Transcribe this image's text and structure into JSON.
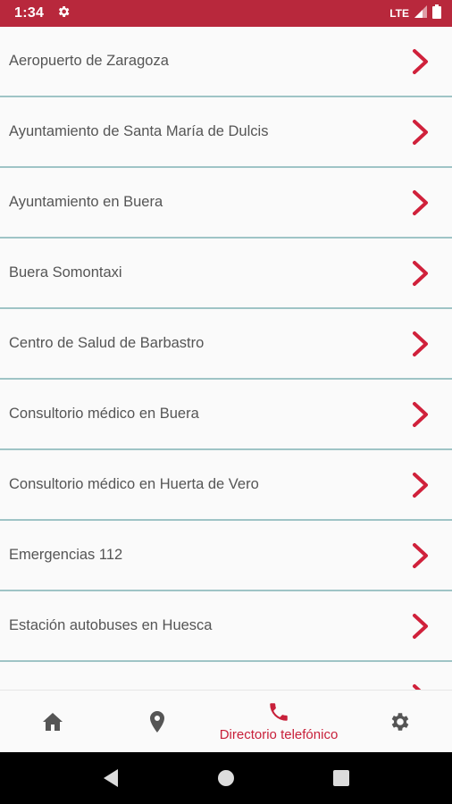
{
  "status_bar": {
    "time": "1:34",
    "network": "LTE",
    "background_color": "#b8283c",
    "icons": [
      "settings-gear-icon",
      "signal-icon",
      "battery-icon"
    ]
  },
  "directory": {
    "items": [
      {
        "label": "Aeropuerto de Zaragoza"
      },
      {
        "label": "Ayuntamiento de Santa María de Dulcis"
      },
      {
        "label": "Ayuntamiento en Buera"
      },
      {
        "label": "Buera Somontaxi"
      },
      {
        "label": "Centro de Salud de Barbastro"
      },
      {
        "label": "Consultorio médico en Buera"
      },
      {
        "label": "Consultorio médico en Huerta de Vero"
      },
      {
        "label": "Emergencias 112"
      },
      {
        "label": "Estación autobuses en Huesca"
      },
      {
        "label": ""
      }
    ],
    "chevron_color": "#d0213b",
    "divider_color": "#9fc4c6"
  },
  "bottom_nav": {
    "items": [
      {
        "name": "home",
        "icon": "home-icon",
        "label": ""
      },
      {
        "name": "map",
        "icon": "location-pin-icon",
        "label": ""
      },
      {
        "name": "directory",
        "icon": "phone-icon",
        "label": "Directorio telefónico",
        "active": true
      },
      {
        "name": "settings",
        "icon": "gear-icon",
        "label": ""
      }
    ],
    "active_color": "#c8203a",
    "inactive_color": "#555555"
  },
  "system_nav": {
    "buttons": [
      "back-icon",
      "home-circle-icon",
      "recents-square-icon"
    ]
  }
}
